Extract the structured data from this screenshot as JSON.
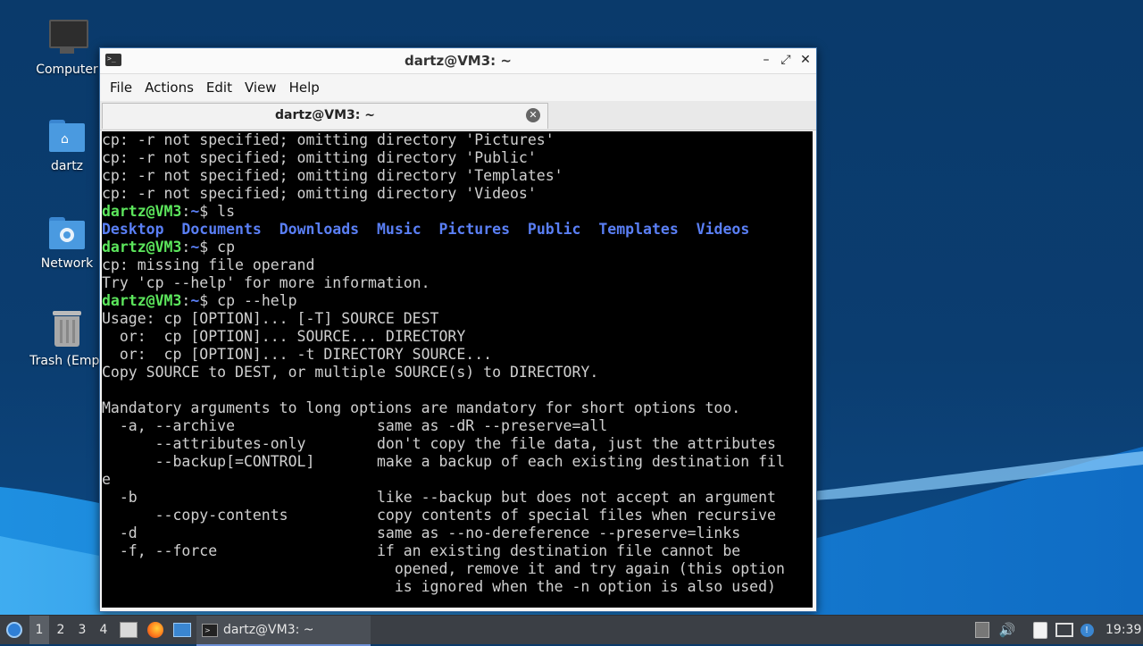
{
  "desktop": {
    "icons": [
      {
        "label": "Computer",
        "icon": "computer-icon"
      },
      {
        "label": "dartz",
        "icon": "home-folder-icon"
      },
      {
        "label": "Network",
        "icon": "network-folder-icon"
      },
      {
        "label": "Trash (Empt",
        "icon": "trash-icon"
      }
    ]
  },
  "window": {
    "title": "dartz@VM3: ~",
    "controls": {
      "minimize": "–",
      "maximize": "⤢",
      "close": "✕"
    },
    "menu": [
      "File",
      "Actions",
      "Edit",
      "View",
      "Help"
    ],
    "tab": {
      "label": "dartz@VM3: ~",
      "close": "✕"
    }
  },
  "terminal": {
    "prompt_user": "dartz@VM3",
    "prompt_path": "~",
    "lines_top": [
      "cp: -r not specified; omitting directory 'Pictures'",
      "cp: -r not specified; omitting directory 'Public'",
      "cp: -r not specified; omitting directory 'Templates'",
      "cp: -r not specified; omitting directory 'Videos'"
    ],
    "cmd1": "ls",
    "ls_dirs": [
      "Desktop",
      "Documents",
      "Downloads",
      "Music",
      "Pictures",
      "Public",
      "Templates",
      "Videos"
    ],
    "cmd2": "cp",
    "cp_out": [
      "cp: missing file operand",
      "Try 'cp --help' for more information."
    ],
    "cmd3": "cp --help",
    "help_lines": [
      "Usage: cp [OPTION]... [-T] SOURCE DEST",
      "  or:  cp [OPTION]... SOURCE... DIRECTORY",
      "  or:  cp [OPTION]... -t DIRECTORY SOURCE...",
      "Copy SOURCE to DEST, or multiple SOURCE(s) to DIRECTORY.",
      "",
      "Mandatory arguments to long options are mandatory for short options too.",
      "  -a, --archive                same as -dR --preserve=all",
      "      --attributes-only        don't copy the file data, just the attributes",
      "      --backup[=CONTROL]       make a backup of each existing destination fil",
      "e",
      "  -b                           like --backup but does not accept an argument",
      "      --copy-contents          copy contents of special files when recursive",
      "  -d                           same as --no-dereference --preserve=links",
      "  -f, --force                  if an existing destination file cannot be",
      "                                 opened, remove it and try again (this option",
      "                                 is ignored when the -n option is also used)"
    ]
  },
  "taskbar": {
    "workspaces": [
      "1",
      "2",
      "3",
      "4"
    ],
    "active_workspace": "1",
    "task_label": "dartz@VM3: ~",
    "clock": "19:39"
  },
  "colors": {
    "prompt_user": "#5ce65c",
    "prompt_path": "#5a7ff5",
    "directory": "#5a7ff5",
    "terminal_bg": "#000000",
    "taskbar_bg": "#3b3f45"
  }
}
